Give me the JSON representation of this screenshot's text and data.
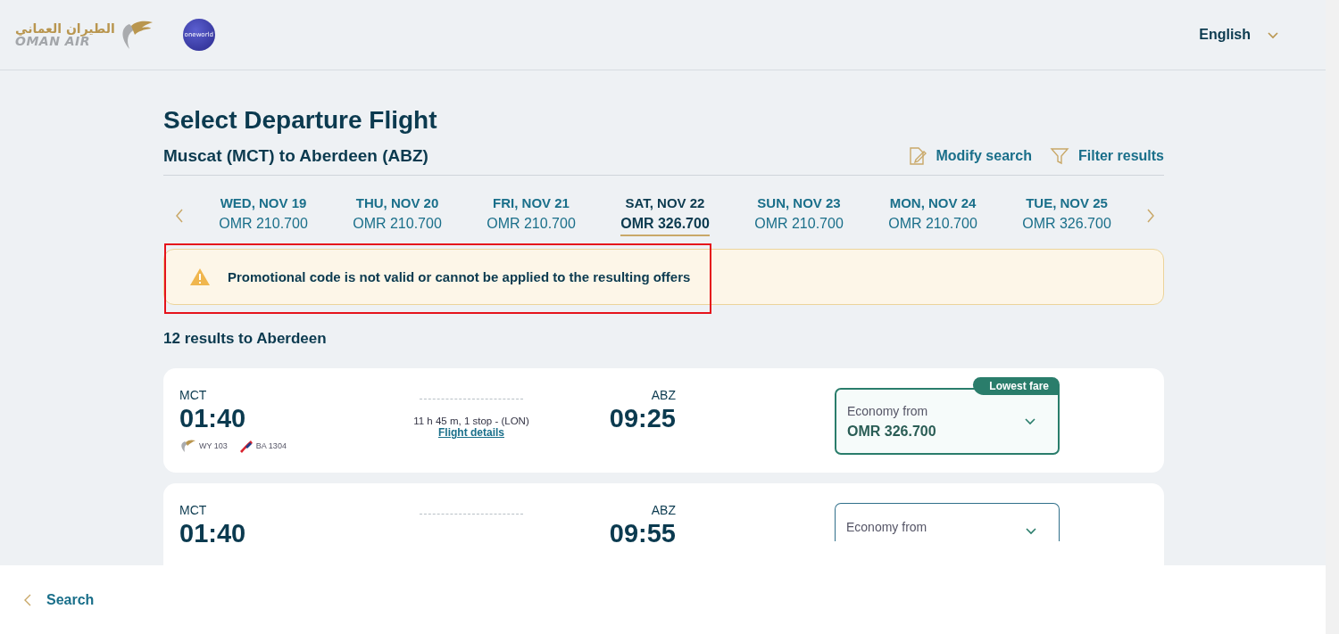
{
  "header": {
    "logo": {
      "arabic": "الطيران العماني",
      "english": "OMAN AIR"
    },
    "alliance_badge": "oneworld",
    "language": "English"
  },
  "page": {
    "title": "Select Departure Flight",
    "route": "Muscat (MCT) to Aberdeen (ABZ)",
    "actions": [
      {
        "label": "Modify search",
        "kind": "edit"
      },
      {
        "label": "Filter results",
        "kind": "filter"
      }
    ]
  },
  "date_tabs": [
    {
      "day": "WED, NOV 19",
      "price": "OMR 210.700",
      "selected": false
    },
    {
      "day": "THU, NOV 20",
      "price": "OMR 210.700",
      "selected": false
    },
    {
      "day": "FRI, NOV 21",
      "price": "OMR 210.700",
      "selected": false
    },
    {
      "day": "SAT, NOV 22",
      "price": "OMR 326.700",
      "selected": true
    },
    {
      "day": "SUN, NOV 23",
      "price": "OMR 210.700",
      "selected": false
    },
    {
      "day": "MON, NOV 24",
      "price": "OMR 210.700",
      "selected": false
    },
    {
      "day": "TUE, NOV 25",
      "price": "OMR 326.700",
      "selected": false
    }
  ],
  "alert": {
    "message": "Promotional code is not valid or cannot be applied to the resulting offers",
    "highlighted": true
  },
  "results_count": "12 results to Aberdeen",
  "flights": [
    {
      "origin": "MCT",
      "departure": "01:40",
      "duration": "11 h 45 m, 1 stop - (LON)",
      "details_link": "Flight details",
      "destination": "ABZ",
      "arrival": "09:25",
      "carriers": [
        {
          "code": "WY 103",
          "kind": "oman"
        },
        {
          "code": "BA 1304",
          "kind": "ba"
        }
      ],
      "fare": {
        "label": "Economy from",
        "price": "OMR 326.700",
        "badge": "Lowest fare"
      }
    },
    {
      "origin": "MCT",
      "departure": "01:40",
      "destination": "ABZ",
      "arrival": "09:55",
      "fare": {
        "label": "Economy from"
      }
    }
  ],
  "footer": {
    "back_link": "Search"
  }
}
